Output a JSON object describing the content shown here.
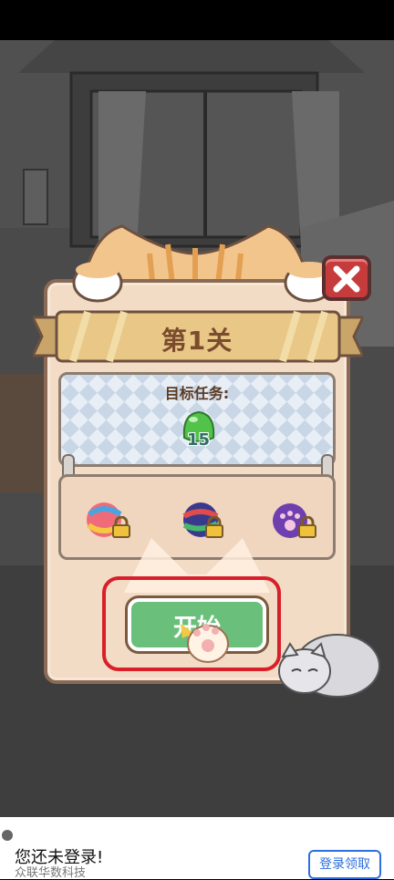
{
  "level": {
    "title": "第1关",
    "target_label": "目标任务:",
    "target_count": "15",
    "start_label": "开始"
  },
  "icons": {
    "close": "close-icon",
    "jelly": "green-jelly-icon",
    "boost_items": [
      "rainbow-yarn-icon",
      "rainbow-ball-icon",
      "purple-paw-ball-icon"
    ],
    "lock": "lock-icon"
  },
  "ad_bar": {
    "title": "您还未登录!",
    "subtitle": "众联华数科技",
    "button": "登录领取"
  },
  "colors": {
    "accent_red": "#d81f2a",
    "start_green": "#6ac07a",
    "panel_brown": "#8a6a55",
    "link_blue": "#2d6fe0"
  }
}
